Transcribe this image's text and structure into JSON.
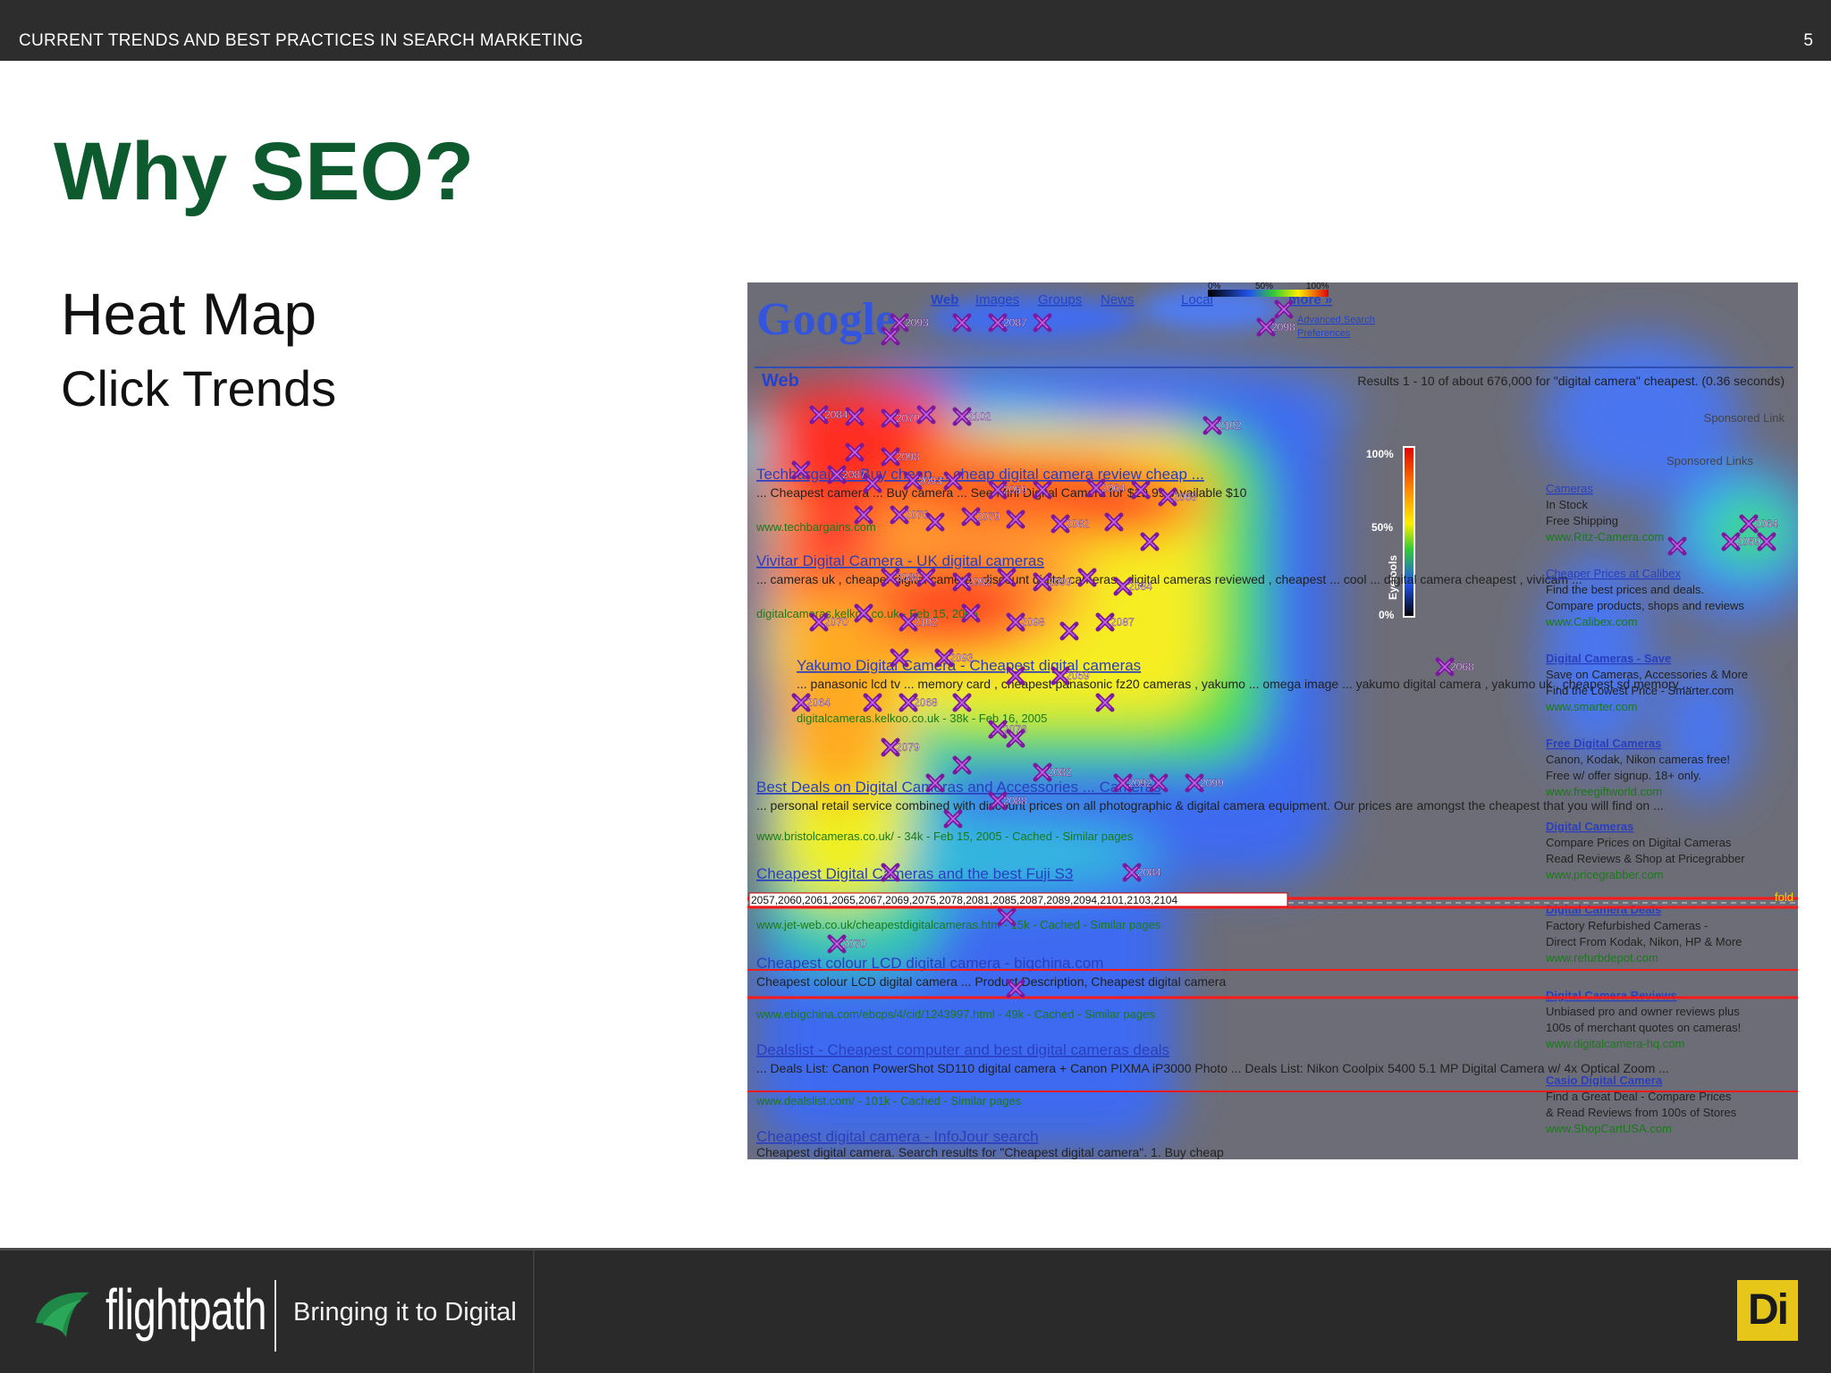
{
  "header": {
    "title": "CURRENT TRENDS AND BEST PRACTICES IN SEARCH MARKETING",
    "page_number": "5"
  },
  "slide": {
    "heading": "Why SEO?",
    "subheading": "Heat Map",
    "subheading2": "Click Trends"
  },
  "heatmap": {
    "nav": [
      "Web",
      "Images",
      "Groups",
      "News",
      "Local",
      "more »"
    ],
    "logo": "Google",
    "advanced": "Advanced Search",
    "preferences": "Preferences",
    "section": "Web",
    "results_line": "Results 1 - 10 of about 676,000 for \"digital camera\" cheapest. (0.36 seconds)",
    "sponsored_link": "Sponsored Link",
    "sponsored_links": "Sponsored Links",
    "legend": [
      "0%",
      "50%",
      "100%"
    ],
    "scale": [
      "100%",
      "50%",
      "0%"
    ],
    "scale_label": "Eyetools",
    "fold": "fold",
    "fold_numbers": "2057,2060,2061,2065,2067,2069,2075,2078,2081,2085,2087,2089,2094,2101,2103,2104",
    "results": [
      {
        "title": "Techbargains - Buy cheap ... cheap digital camera review cheap ...",
        "snippet": "... Cheapest camera ... Buy camera ... See Mini Digital Camera for $19.99. Available $10",
        "url": "www.techbargains.com"
      },
      {
        "title": "Vivitar Digital Camera - UK digital cameras",
        "snippet": "... cameras uk , cheaper digital camera , discount digital cameras , digital cameras reviewed , cheapest ... cool ... digital camera cheapest , vivicam ...",
        "url": "digitalcameras.kelkoo.co.uk - Feb 15, 2005"
      },
      {
        "title": "Yakumo Digital Camera - Cheapest digital cameras",
        "snippet": "... panasonic lcd tv ... memory card , cheapest panasonic fz20 cameras , yakumo ... omega image ... yakumo digital camera , yakumo uk , cheapest sd memory ...",
        "url": "digitalcameras.kelkoo.co.uk - 38k - Feb 16, 2005"
      },
      {
        "title": "Best Deals on Digital Cameras and Accessories ... Cameras",
        "snippet": "... personal retail service combined with discount prices on all photographic & digital camera equipment. Our prices are amongst the cheapest that you will find on ...",
        "url": "www.bristolcameras.co.uk/ - 34k - Feb 15, 2005 - Cached - Similar pages"
      },
      {
        "title": "Cheapest Digital Cameras and the best Fuji S3",
        "snippet": "",
        "url": "www.jet-web.co.uk/cheapestdigitalcameras.htm - 15k - Cached - Similar pages"
      },
      {
        "title": "Cheapest colour LCD digital camera - bigchina.com",
        "snippet": "Cheapest colour LCD digital camera ... Product Description, Cheapest digital camera",
        "url": "www.ebigchina.com/ebcps/4/cid/1243997.html - 49k - Cached - Similar pages"
      },
      {
        "title": "Dealslist - Cheapest computer and best digital cameras deals",
        "snippet": "... Deals List: Canon PowerShot SD110 digital camera + Canon PIXMA iP3000 Photo ... Deals List: Nikon Coolpix 5400 5.1 MP Digital Camera w/ 4x Optical Zoom ...",
        "url": "www.dealslist.com/ - 101k - Cached - Similar pages"
      },
      {
        "title": "Cheapest digital camera - InfoJour search",
        "snippet": "Cheapest digital camera. Search results for \"Cheapest digital camera\". 1. Buy cheap",
        "url": ""
      }
    ],
    "ads": [
      {
        "title": "Cameras",
        "lines": [
          "In Stock",
          "Free Shipping",
          "www.Ritz-Camera.com"
        ]
      },
      {
        "title": "Cheaper Prices at Calibex",
        "lines": [
          "Find the best prices and deals.",
          "Compare products, shops and reviews",
          "www.Calibex.com"
        ]
      },
      {
        "title": "Digital Cameras - Save",
        "lines": [
          "Save on Cameras, Accessories & More",
          "Find the Lowest Price - Smarter.com",
          "www.smarter.com"
        ]
      },
      {
        "title": "Free Digital Cameras",
        "lines": [
          "Canon, Kodak, Nikon cameras free!",
          "Free w/ offer signup. 18+ only.",
          "www.freegiftworld.com"
        ]
      },
      {
        "title": "Digital Cameras",
        "lines": [
          "Compare Prices on Digital Cameras",
          "Read Reviews & Shop at Pricegrabber",
          "www.pricegrabber.com"
        ]
      },
      {
        "title": "Digital Camera Deals",
        "lines": [
          "Factory Refurbished Cameras -",
          "Direct From Kodak, Nikon, HP & More",
          "www.refurbdepot.com"
        ]
      },
      {
        "title": "Digital Camera Reviews",
        "lines": [
          "Unbiased pro and owner reviews plus",
          "100s of merchant quotes on cameras!",
          "www.digitalcamera-hq.com"
        ]
      },
      {
        "title": "Casio Digital Camera",
        "lines": [
          "Find a Great Deal - Compare Prices",
          "& Read Reviews from 100s of Stores",
          "www.ShopCartUSA.com"
        ]
      }
    ],
    "labels": [
      "2084",
      "2057",
      "2070",
      "2074",
      "2102",
      "2096",
      "2098",
      "2071",
      "2087",
      "2083",
      "2093",
      "2055",
      "2059",
      "2063",
      "2064",
      "2066",
      "2068",
      "2073",
      "2076",
      "2077",
      "2079",
      "2080",
      "2082",
      "2086",
      "2088",
      "2090",
      "2092",
      "2095",
      "2099",
      "2100"
    ]
  },
  "footer": {
    "brand": "flightpath",
    "tagline": "Bringing it to Digital",
    "badge": "Di"
  },
  "colors": {
    "heading": "#0e5a2f",
    "bar": "#2d2d2d",
    "badge": "#e6c619"
  }
}
